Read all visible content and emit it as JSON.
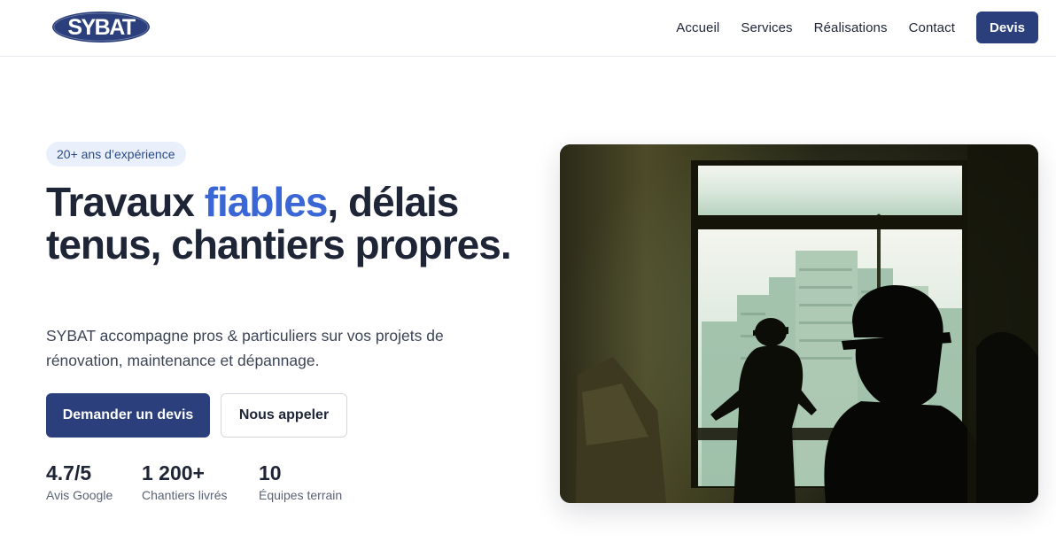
{
  "brand": {
    "logo_text": "SYBAT",
    "logo_color": "#2a3f7c"
  },
  "nav": {
    "items": [
      {
        "label": "Accueil"
      },
      {
        "label": "Services"
      },
      {
        "label": "Réalisations"
      },
      {
        "label": "Contact"
      }
    ],
    "cta_label": "Devis"
  },
  "hero": {
    "badge": "20+ ans d’expérience",
    "title_part1": "Travaux ",
    "title_accent": "fiables",
    "title_part2": ", délais tenus, chantiers propres.",
    "subtitle": "SYBAT accompagne pros & particuliers sur vos projets de rénovation, maintenance et dépannage.",
    "primary_button": "Demander un devis",
    "secondary_button": "Nous appeler",
    "stats": [
      {
        "value": "4.7/5",
        "label": "Avis Google"
      },
      {
        "value": "1 200+",
        "label": "Chantiers livrés"
      },
      {
        "value": "10",
        "label": "Équipes terrain"
      }
    ]
  },
  "colors": {
    "primary": "#2a3f7c",
    "accent": "#3b66d6",
    "text": "#1e2536",
    "badge_bg": "#eaf0fb"
  }
}
